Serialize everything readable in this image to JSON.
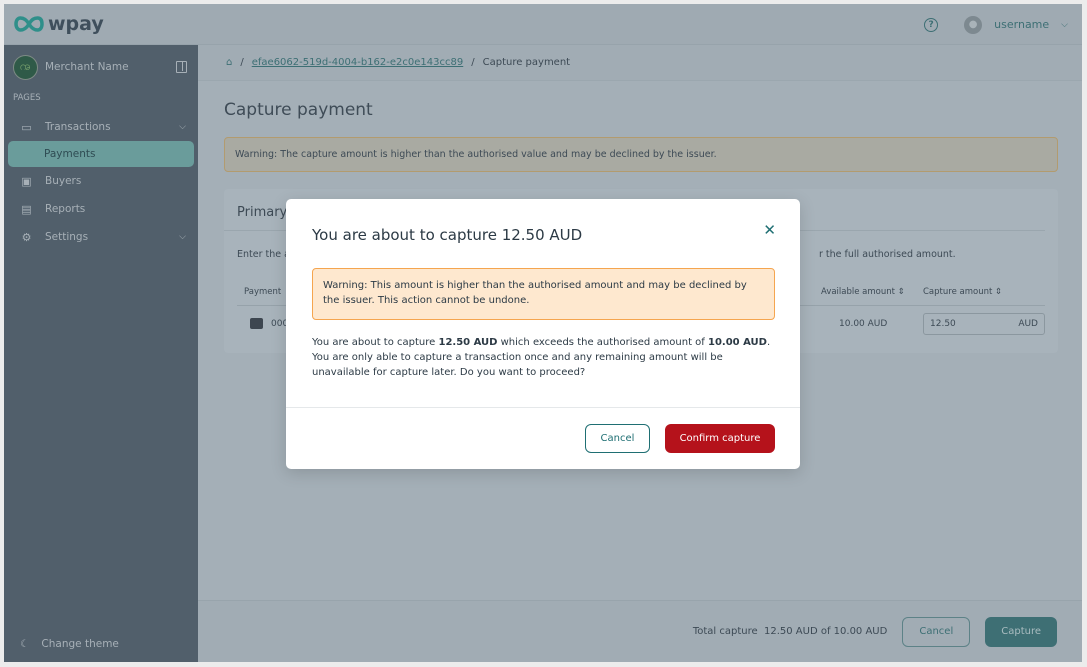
{
  "header": {
    "brand": "wpay",
    "help_icon": "?",
    "username": "username"
  },
  "sidebar": {
    "merchant": "Merchant Name",
    "section": "PAGES",
    "items": [
      {
        "label": "Transactions",
        "icon": "card-icon"
      },
      {
        "label": "Payments"
      },
      {
        "label": "Buyers",
        "icon": "contact-icon"
      },
      {
        "label": "Reports",
        "icon": "clipboard-icon"
      },
      {
        "label": "Settings",
        "icon": "gear-icon"
      }
    ],
    "change_theme": "Change theme"
  },
  "breadcrumb": {
    "id": "efae6062-519d-4004-b162-e2c0e143cc89",
    "current": "Capture payment"
  },
  "page": {
    "title": "Capture payment",
    "warning": "Warning: The capture amount is higher than the authorised value and may be declined by the issuer.",
    "card_title": "Primary",
    "desc_start": "Enter the a",
    "desc_end": "r the full authorised amount.",
    "col_payment": "Payment",
    "col_available": "Available amount",
    "col_capture": "Capture amount",
    "row": {
      "card_prefix": "000",
      "available": "10.00 AUD",
      "capture_value": "12.50",
      "capture_currency": "AUD"
    }
  },
  "footer": {
    "total_label": "Total capture",
    "total_value": "12.50 AUD of 10.00 AUD",
    "cancel": "Cancel",
    "capture": "Capture"
  },
  "modal": {
    "title": "You are about to capture 12.50 AUD",
    "warning": "Warning: This amount is higher than the authorised amount and may be declined by the issuer. This action cannot be undone.",
    "body_1": "You are about to capture ",
    "amount": "12.50 AUD",
    "body_2": " which exceeds the authorised amount of ",
    "authorised": "10.00 AUD",
    "body_3": ". You are only able to capture a transaction once and any remaining amount will be unavailable for capture later. Do you want to proceed?",
    "cancel": "Cancel",
    "confirm": "Confirm capture"
  },
  "colors": {
    "accent": "#1f6f73",
    "danger": "#b5121b",
    "warning_bg": "#fee8cf"
  }
}
